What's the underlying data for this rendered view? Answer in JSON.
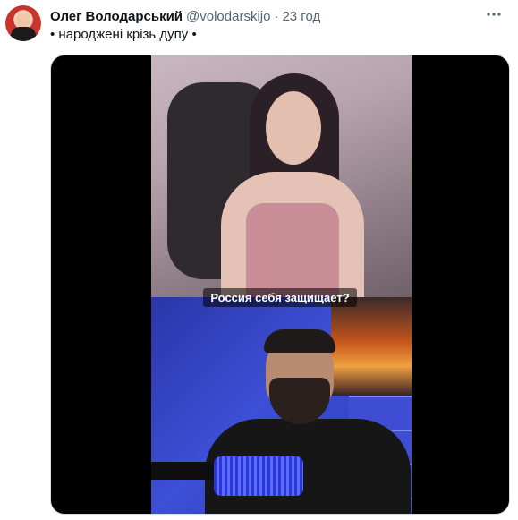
{
  "tweet": {
    "display_name": "Олег Володарський",
    "handle": "@volodarskijo",
    "separator": "·",
    "time": "23 год",
    "text": "• народжені крізь дупу •",
    "more_icon": "more-horizontal-icon"
  },
  "media": {
    "caption": "Россия себя защищает?"
  }
}
